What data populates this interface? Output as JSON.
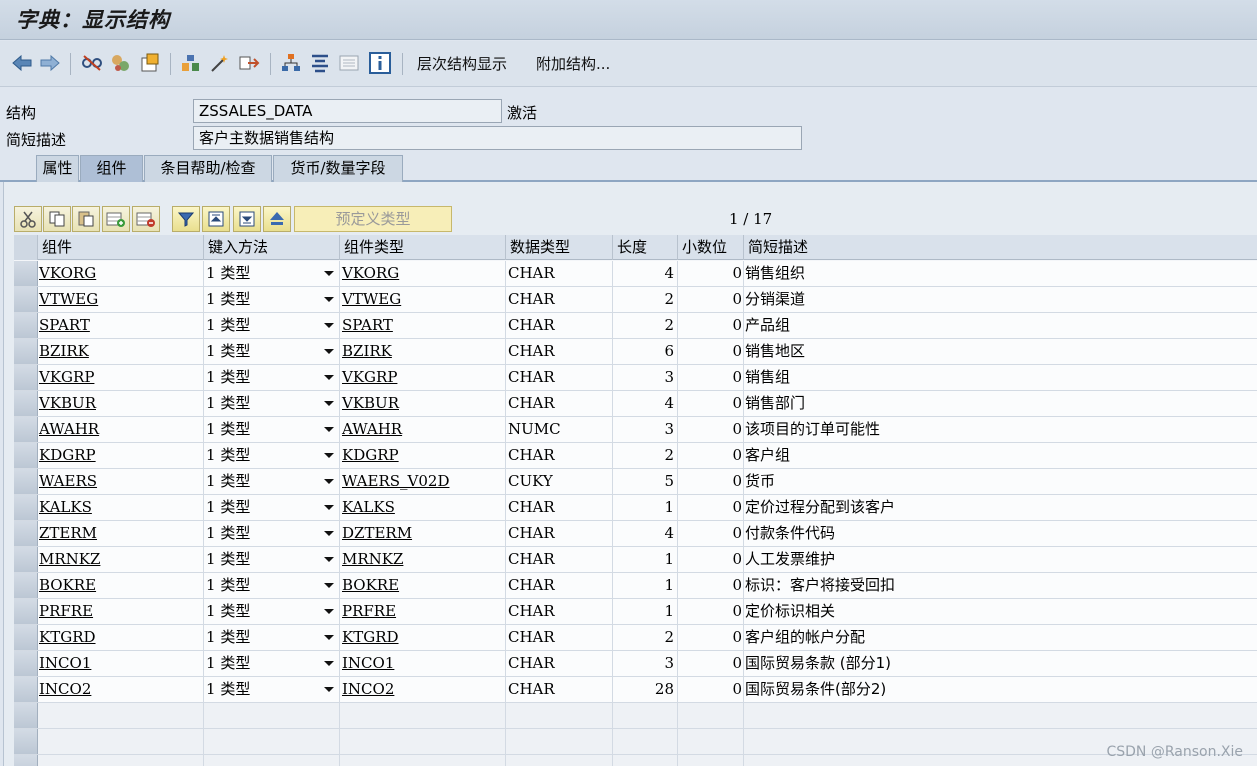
{
  "window": {
    "title": "字典：显示结构"
  },
  "toolbar": {
    "buttons": [
      "back-icon",
      "forward-icon",
      "toggle-display-icon",
      "other-object-icon",
      "activate-icon",
      "where-used-icon",
      "object-list-icon",
      "navigate-icon",
      "hierarchy-icon",
      "distribute-icon",
      "list-icon",
      "info-icon"
    ],
    "hierarchy_label": "层次结构显示",
    "append_label": "附加结构..."
  },
  "header": {
    "structure_label": "结构",
    "structure_value": "ZSSALES_DATA",
    "status": "激活",
    "desc_label": "简短描述",
    "desc_value": "客户主数据销售结构"
  },
  "tabs": [
    "属性",
    "组件",
    "条目帮助/检查",
    "货币/数量字段"
  ],
  "active_tab": "组件",
  "table_toolbar": {
    "predefined_type": "预定义类型",
    "pager": "1 / 17"
  },
  "table": {
    "columns": [
      "组件",
      "键入方法",
      "组件类型",
      "数据类型",
      "长度",
      "小数位",
      "简短描述"
    ],
    "rows": [
      {
        "component": "VKORG",
        "typing": "1",
        "typing_label": "类型",
        "comp_type": "VKORG",
        "dtype": "CHAR",
        "length": "4",
        "decimals": "0",
        "desc": "销售组织"
      },
      {
        "component": "VTWEG",
        "typing": "1",
        "typing_label": "类型",
        "comp_type": "VTWEG",
        "dtype": "CHAR",
        "length": "2",
        "decimals": "0",
        "desc": "分销渠道"
      },
      {
        "component": "SPART",
        "typing": "1",
        "typing_label": "类型",
        "comp_type": "SPART",
        "dtype": "CHAR",
        "length": "2",
        "decimals": "0",
        "desc": "产品组"
      },
      {
        "component": "BZIRK",
        "typing": "1",
        "typing_label": "类型",
        "comp_type": "BZIRK",
        "dtype": "CHAR",
        "length": "6",
        "decimals": "0",
        "desc": "销售地区"
      },
      {
        "component": "VKGRP",
        "typing": "1",
        "typing_label": "类型",
        "comp_type": "VKGRP",
        "dtype": "CHAR",
        "length": "3",
        "decimals": "0",
        "desc": "销售组"
      },
      {
        "component": "VKBUR",
        "typing": "1",
        "typing_label": "类型",
        "comp_type": "VKBUR",
        "dtype": "CHAR",
        "length": "4",
        "decimals": "0",
        "desc": "销售部门"
      },
      {
        "component": "AWAHR",
        "typing": "1",
        "typing_label": "类型",
        "comp_type": "AWAHR",
        "dtype": "NUMC",
        "length": "3",
        "decimals": "0",
        "desc": "该项目的订单可能性"
      },
      {
        "component": "KDGRP",
        "typing": "1",
        "typing_label": "类型",
        "comp_type": "KDGRP",
        "dtype": "CHAR",
        "length": "2",
        "decimals": "0",
        "desc": "客户组"
      },
      {
        "component": "WAERS",
        "typing": "1",
        "typing_label": "类型",
        "comp_type": "WAERS_V02D",
        "dtype": "CUKY",
        "length": "5",
        "decimals": "0",
        "desc": "货币"
      },
      {
        "component": "KALKS",
        "typing": "1",
        "typing_label": "类型",
        "comp_type": "KALKS",
        "dtype": "CHAR",
        "length": "1",
        "decimals": "0",
        "desc": "定价过程分配到该客户"
      },
      {
        "component": "ZTERM",
        "typing": "1",
        "typing_label": "类型",
        "comp_type": "DZTERM",
        "dtype": "CHAR",
        "length": "4",
        "decimals": "0",
        "desc": "付款条件代码"
      },
      {
        "component": "MRNKZ",
        "typing": "1",
        "typing_label": "类型",
        "comp_type": "MRNKZ",
        "dtype": "CHAR",
        "length": "1",
        "decimals": "0",
        "desc": "人工发票维护"
      },
      {
        "component": "BOKRE",
        "typing": "1",
        "typing_label": "类型",
        "comp_type": "BOKRE",
        "dtype": "CHAR",
        "length": "1",
        "decimals": "0",
        "desc": "标识：客户将接受回扣"
      },
      {
        "component": "PRFRE",
        "typing": "1",
        "typing_label": "类型",
        "comp_type": "PRFRE",
        "dtype": "CHAR",
        "length": "1",
        "decimals": "0",
        "desc": "定价标识相关"
      },
      {
        "component": "KTGRD",
        "typing": "1",
        "typing_label": "类型",
        "comp_type": "KTGRD",
        "dtype": "CHAR",
        "length": "2",
        "decimals": "0",
        "desc": "客户组的帐户分配"
      },
      {
        "component": "INCO1",
        "typing": "1",
        "typing_label": "类型",
        "comp_type": "INCO1",
        "dtype": "CHAR",
        "length": "3",
        "decimals": "0",
        "desc": "国际贸易条款 (部分1)"
      },
      {
        "component": "INCO2",
        "typing": "1",
        "typing_label": "类型",
        "comp_type": "INCO2",
        "dtype": "CHAR",
        "length": "28",
        "decimals": "0",
        "desc": "国际贸易条件(部分2)"
      }
    ]
  },
  "watermark": "CSDN @Ranson.Xie",
  "colors": {
    "accent": "#8ea6c2",
    "button_yellow": "#f7eeb8",
    "link": "#000000"
  }
}
